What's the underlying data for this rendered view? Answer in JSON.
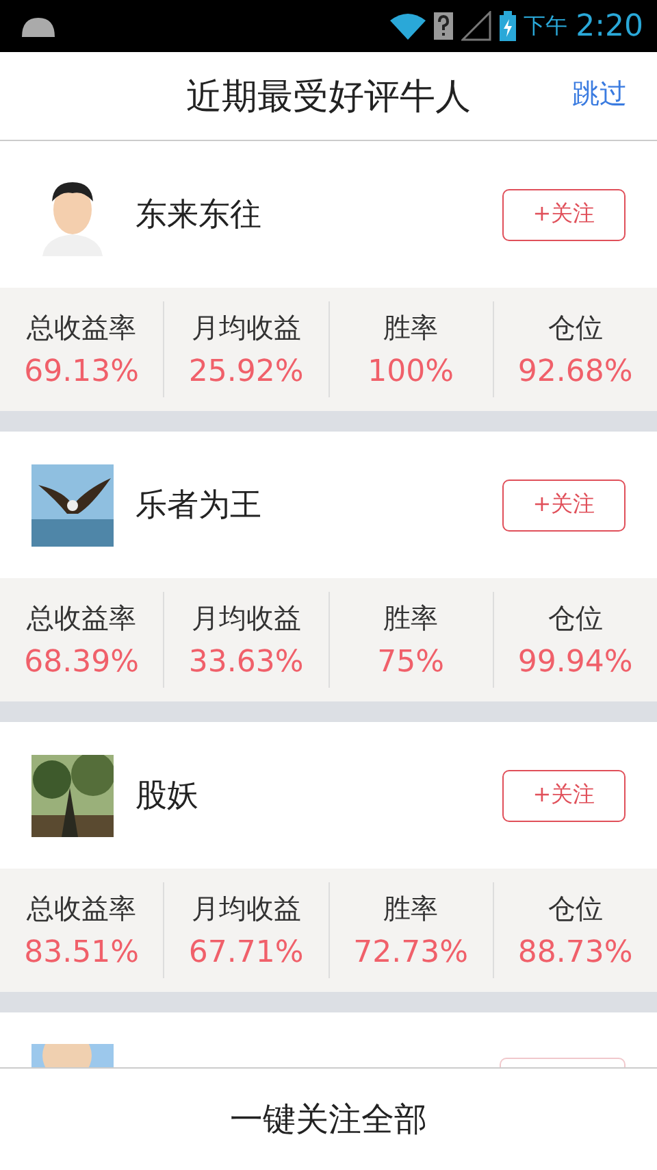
{
  "status_bar": {
    "period": "下午",
    "time": "2:20"
  },
  "header": {
    "title": "近期最受好评牛人",
    "skip": "跳过"
  },
  "users": [
    {
      "name": "东来东往",
      "follow": "+关注",
      "stats": [
        {
          "label": "总收益率",
          "value": "69.13%"
        },
        {
          "label": "月均收益",
          "value": "25.92%"
        },
        {
          "label": "胜率",
          "value": "100%"
        },
        {
          "label": "仓位",
          "value": "92.68%"
        }
      ]
    },
    {
      "name": "乐者为王",
      "follow": "+关注",
      "stats": [
        {
          "label": "总收益率",
          "value": "68.39%"
        },
        {
          "label": "月均收益",
          "value": "33.63%"
        },
        {
          "label": "胜率",
          "value": "75%"
        },
        {
          "label": "仓位",
          "value": "99.94%"
        }
      ]
    },
    {
      "name": "股妖",
      "follow": "+关注",
      "stats": [
        {
          "label": "总收益率",
          "value": "83.51%"
        },
        {
          "label": "月均收益",
          "value": "67.71%"
        },
        {
          "label": "胜率",
          "value": "72.73%"
        },
        {
          "label": "仓位",
          "value": "88.73%"
        }
      ]
    }
  ],
  "footer": {
    "button": "一键关注全部"
  }
}
